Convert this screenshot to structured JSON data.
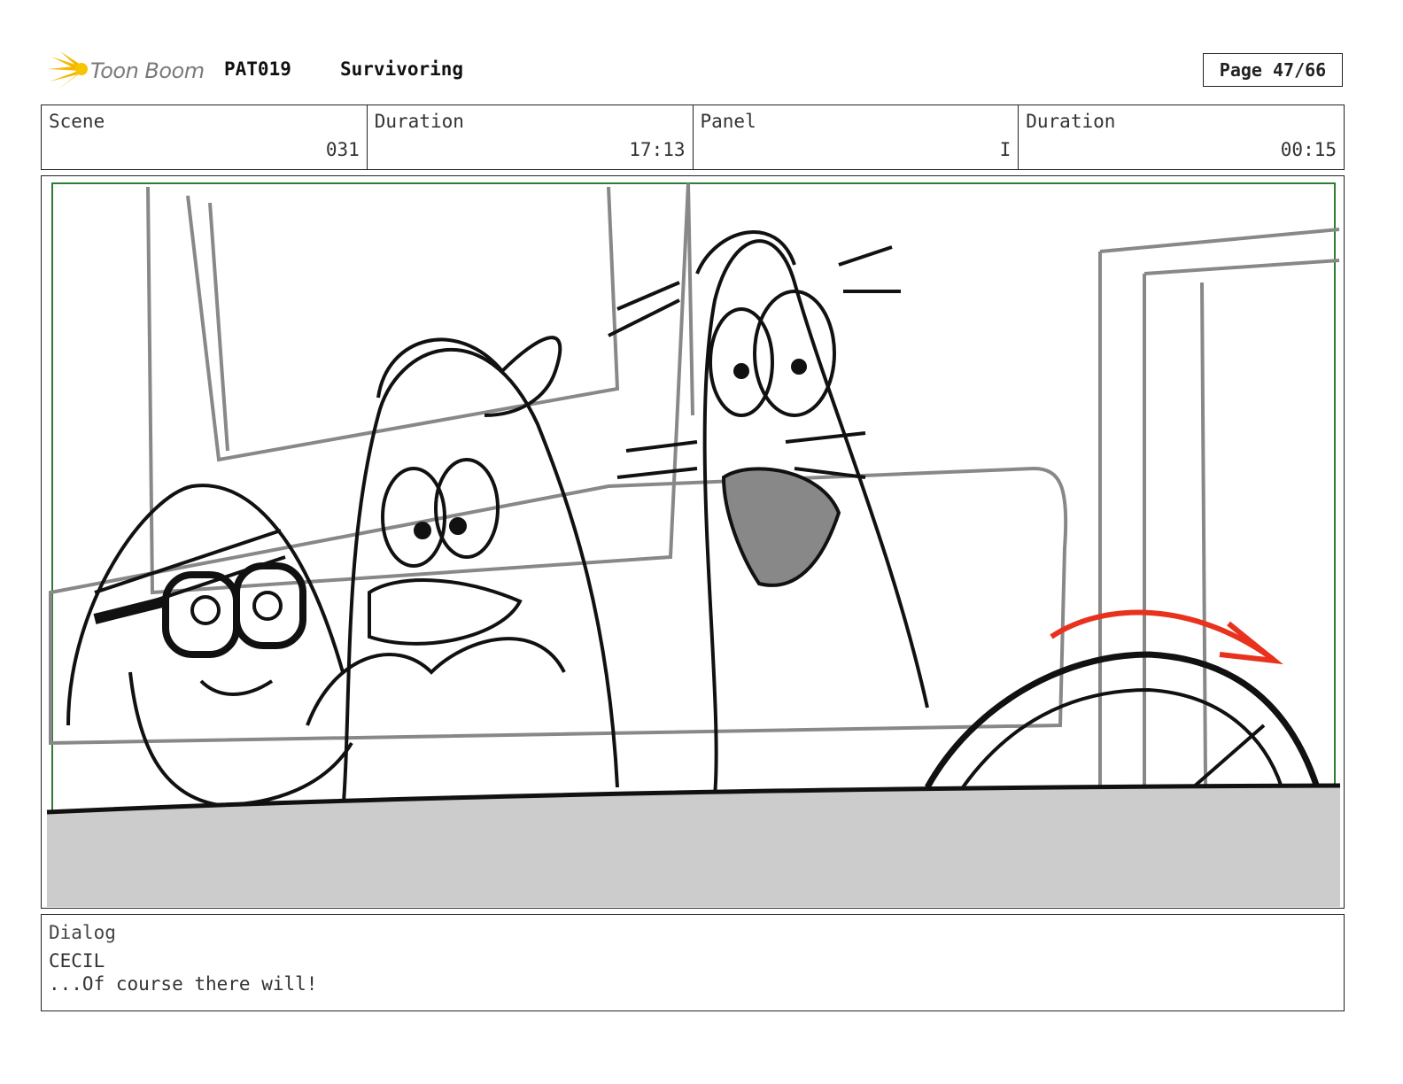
{
  "header": {
    "logo_text": "Toon Boom",
    "project_code": "PAT019",
    "episode_title": "Survivoring",
    "page": "Page 47/66"
  },
  "info": {
    "scene_label": "Scene",
    "scene_value": "031",
    "duration_label": "Duration",
    "duration_value": "17:13",
    "panel_label": "Panel",
    "panel_value": "I",
    "panel_duration_label": "Duration",
    "panel_duration_value": "00:15"
  },
  "panel_image": {
    "icon": "storyboard-sketch-car-scene",
    "accent_color": "#e8321e",
    "frame_color": "#2e7d32"
  },
  "dialog": {
    "label": "Dialog",
    "speaker": "CECIL",
    "line": "...Of course there will!"
  }
}
